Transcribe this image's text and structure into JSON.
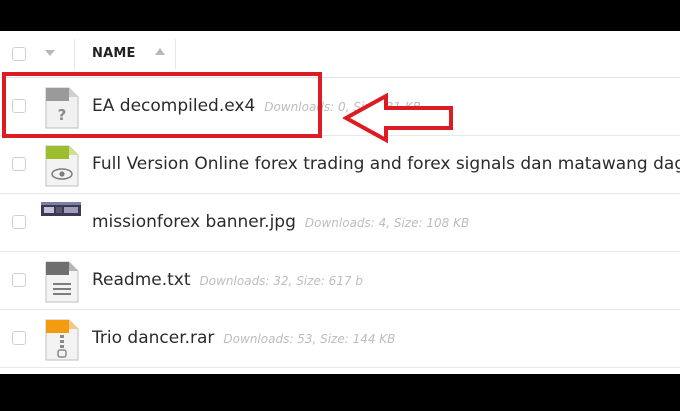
{
  "header": {
    "column_name": "NAME"
  },
  "files": [
    {
      "name": "EA decompiled.ex4",
      "meta": "Downloads: 0, Size: 31 KB",
      "icon": "unknown-file-icon"
    },
    {
      "name": "Full Version Online forex trading and forex signals dan matawang dagangan",
      "meta": "",
      "icon": "eye-document-icon"
    },
    {
      "name": "missionforex banner.jpg",
      "meta": "Downloads: 4, Size: 108 KB",
      "icon": "image-thumbnail-icon"
    },
    {
      "name": "Readme.txt",
      "meta": "Downloads: 32, Size: 617 b",
      "icon": "text-file-icon"
    },
    {
      "name": "Trio dancer.rar",
      "meta": "Downloads: 53, Size: 144 KB",
      "icon": "archive-file-icon"
    }
  ],
  "colors": {
    "highlight": "#dd1b22",
    "meta_text": "#bdbdbd",
    "border": "#e8e8e8"
  }
}
